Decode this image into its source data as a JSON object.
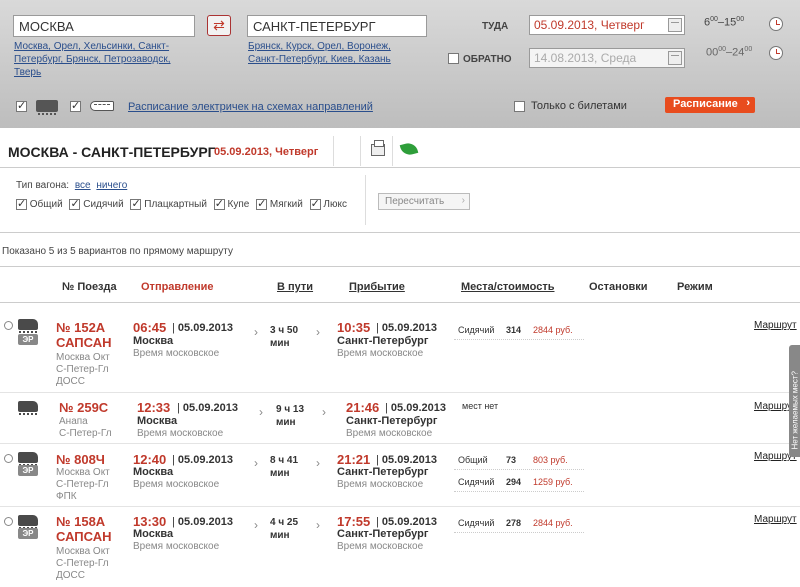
{
  "search": {
    "from_value": "МОСКВА",
    "to_value": "САНКТ-ПЕТЕРБУРГ",
    "from_suggestions": [
      "Москва, Орел, Хельсинки, Санкт-",
      "Петербург, Брянск, Петрозаводск,",
      "Тверь"
    ],
    "to_suggestions": [
      "Брянск, Курск, Орел, Воронеж,",
      "Санкт-Петербург, Киев, Казань"
    ],
    "there_label": "ТУДА",
    "there_date": "05.09.2013, Четверг",
    "there_time_from": "6",
    "there_time_from_sup": "00",
    "there_time_to": "15",
    "there_time_to_sup": "00",
    "back_label": "ОБРАТНО",
    "back_date": "14.08.2013, Среда",
    "back_time_from": "00",
    "back_time_from_sup": "00",
    "back_time_to": "24",
    "back_time_to_sup": "00",
    "schedule_link": "Расписание электричек на схемах направлений",
    "only_tickets_label": "Только с билетами",
    "submit_label": "Расписание"
  },
  "route_title": {
    "route": "МОСКВА - САНКТ-ПЕТЕРБУРГ",
    "date": "05.09.2013, Четверг"
  },
  "filters": {
    "wagon_type_label": "Тип вагона:",
    "all_link": "все",
    "none_link": "ничего",
    "options": [
      "Общий",
      "Сидячий",
      "Плацкартный",
      "Купе",
      "Мягкий",
      "Люкс"
    ],
    "recalc_label": "Пересчитать"
  },
  "shown_text": "Показано 5 из 5 вариантов по прямому маршруту",
  "table_headers": {
    "train": "№ Поезда",
    "departure": "Отправление",
    "travel": "В пути",
    "arrival": "Прибытие",
    "seats": "Места/стоимость",
    "stops": "Остановки",
    "mode": "Режим"
  },
  "trains": [
    {
      "number": "№ 152А",
      "name": "САПСАН",
      "tag": "ЭР",
      "route": [
        "Москва Окт",
        "С-Петер-Гл",
        "ДОСС"
      ],
      "dep_time": "06:45",
      "dep_date": "05.09.2013",
      "dep_station": "Москва",
      "dep_tz": "Время московское",
      "dur1": "3 ч 50",
      "dur2": "мин",
      "arr_time": "10:35",
      "arr_date": "05.09.2013",
      "arr_station": "Санкт-Петербург",
      "arr_tz": "Время московское",
      "seats": [
        {
          "type": "Сидячий",
          "count": "314",
          "price": "2844 руб."
        }
      ],
      "route_link": "Маршрут"
    },
    {
      "number": "№ 259С",
      "name": "",
      "tag": "",
      "route": [
        "Анапа",
        "С-Петер-Гл"
      ],
      "dep_time": "12:33",
      "dep_date": "05.09.2013",
      "dep_station": "Москва",
      "dep_tz": "Время московское",
      "dur1": "9 ч 13",
      "dur2": "мин",
      "arr_time": "21:46",
      "arr_date": "05.09.2013",
      "arr_station": "Санкт-Петербург",
      "arr_tz": "Время московское",
      "no_seats": "мест нет",
      "route_link": "Маршрут"
    },
    {
      "number": "№ 808Ч",
      "name": "",
      "tag": "ЭР",
      "route": [
        "Москва Окт",
        "С-Петер-Гл",
        "ФПК"
      ],
      "dep_time": "12:40",
      "dep_date": "05.09.2013",
      "dep_station": "Москва",
      "dep_tz": "Время московское",
      "dur1": "8 ч 41",
      "dur2": "мин",
      "arr_time": "21:21",
      "arr_date": "05.09.2013",
      "arr_station": "Санкт-Петербург",
      "arr_tz": "Время московское",
      "seats": [
        {
          "type": "Общий",
          "count": "73",
          "price": "803 руб."
        },
        {
          "type": "Сидячий",
          "count": "294",
          "price": "1259 руб."
        }
      ],
      "route_link": "Маршрут"
    },
    {
      "number": "№ 158А",
      "name": "САПСАН",
      "tag": "ЭР",
      "route": [
        "Москва Окт",
        "С-Петер-Гл",
        "ДОСС"
      ],
      "dep_time": "13:30",
      "dep_date": "05.09.2013",
      "dep_station": "Москва",
      "dep_tz": "Время московское",
      "dur1": "4 ч 25",
      "dur2": "мин",
      "arr_time": "17:55",
      "arr_date": "05.09.2013",
      "arr_station": "Санкт-Петербург",
      "arr_tz": "Время московское",
      "seats": [
        {
          "type": "Сидячий",
          "count": "278",
          "price": "2844 руб."
        }
      ],
      "route_link": "Маршрут"
    }
  ],
  "side_tab": "Нет желаемых мест?"
}
